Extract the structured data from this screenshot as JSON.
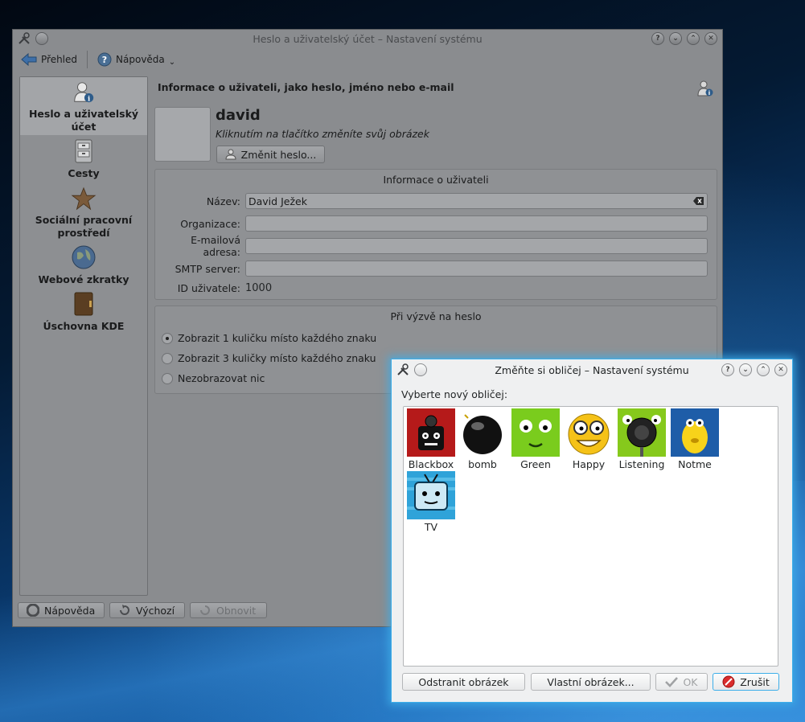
{
  "main_window": {
    "title": "Heslo a uživatelský účet – Nastavení systému",
    "toolbar": {
      "overview": "Přehled",
      "help": "Nápověda"
    },
    "sidebar": [
      {
        "label": "Heslo a uživatelský účet",
        "icon": "user-info-icon",
        "active": true
      },
      {
        "label": "Cesty",
        "icon": "cabinet-icon",
        "active": false
      },
      {
        "label": "Sociální pracovní prostředí",
        "icon": "star-icon",
        "active": false
      },
      {
        "label": "Webové zkratky",
        "icon": "globe-icon",
        "active": false
      },
      {
        "label": "Úschovna KDE",
        "icon": "wallet-icon",
        "active": false
      }
    ],
    "heading": "Informace o uživateli, jako heslo, jméno nebo e-mail",
    "username": "david",
    "avatar_hint": "Kliknutím na tlačítko změníte svůj obrázek",
    "change_password": "Změnit heslo...",
    "user_info_group": {
      "title": "Informace o uživateli",
      "fields": [
        {
          "label": "Název:",
          "value": "David Ježek"
        },
        {
          "label": "Organizace:",
          "value": ""
        },
        {
          "label": "E-mailová adresa:",
          "value": ""
        },
        {
          "label": "SMTP server:",
          "value": ""
        }
      ],
      "uid_label": "ID uživatele:",
      "uid_value": "1000"
    },
    "password_group": {
      "title": "Při výzvě na heslo",
      "options": [
        {
          "label": "Zobrazit 1 kuličku místo každého znaku",
          "selected": true
        },
        {
          "label": "Zobrazit 3 kuličky místo každého znaku",
          "selected": false
        },
        {
          "label": "Nezobrazovat nic",
          "selected": false
        }
      ]
    },
    "buttons": {
      "help": "Nápověda",
      "defaults": "Výchozí",
      "reset": "Obnovit"
    }
  },
  "dialog": {
    "title": "Změňte si obličej – Nastavení systému",
    "prompt": "Vyberte nový obličej:",
    "faces": [
      {
        "name": "Blackbox",
        "color": "#b51a1a"
      },
      {
        "name": "bomb",
        "color": "#ffffff"
      },
      {
        "name": "Green",
        "color": "#7acc1d"
      },
      {
        "name": "Happy",
        "color": "#ffffff"
      },
      {
        "name": "Listening",
        "color": "#86c91c"
      },
      {
        "name": "Notme",
        "color": "#1e5da8"
      },
      {
        "name": "TV",
        "color": "#2fa3d9"
      }
    ],
    "buttons": {
      "remove": "Odstranit obrázek",
      "custom": "Vlastní obrázek...",
      "ok": "OK",
      "cancel": "Zrušit"
    }
  }
}
